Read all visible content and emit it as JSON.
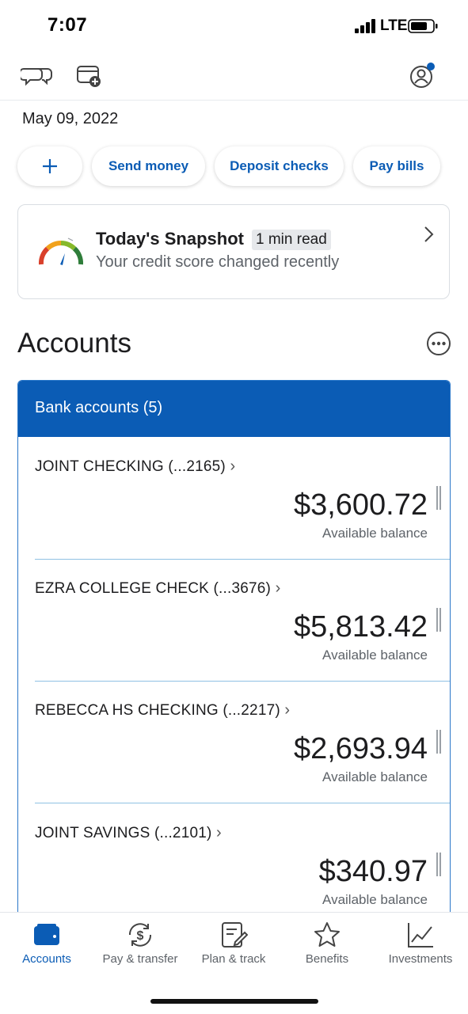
{
  "status_bar": {
    "time": "7:07",
    "network": "LTE"
  },
  "header": {
    "date": "May 09, 2022",
    "icons": [
      "chat-icon",
      "add-card-icon",
      "profile-icon"
    ],
    "profile_notification": true
  },
  "quick_actions": {
    "add_icon": "plus-icon",
    "send_money": "Send money",
    "deposit_checks": "Deposit checks",
    "pay_bills": "Pay bills"
  },
  "snapshot": {
    "icon": "gauge-icon",
    "title": "Today's Snapshot",
    "badge": "1 min read",
    "subtitle": "Your credit score changed recently"
  },
  "accounts": {
    "heading": "Accounts",
    "bank_header": "Bank accounts (5)",
    "items": [
      {
        "name": "JOINT CHECKING (...2165)",
        "amount": "$3,600.72",
        "balance_label": "Available balance"
      },
      {
        "name": "EZRA COLLEGE CHECK (...3676)",
        "amount": "$5,813.42",
        "balance_label": "Available balance"
      },
      {
        "name": "REBECCA HS CHECKING (...2217)",
        "amount": "$2,693.94",
        "balance_label": "Available balance"
      },
      {
        "name": "JOINT SAVINGS (...2101)",
        "amount": "$340.97",
        "balance_label": "Available balance"
      }
    ]
  },
  "bottom_nav": {
    "items": [
      {
        "label": "Accounts",
        "icon": "wallet-icon",
        "active": true
      },
      {
        "label": "Pay & transfer",
        "icon": "pay-transfer-icon",
        "active": false
      },
      {
        "label": "Plan & track",
        "icon": "plan-track-icon",
        "active": false
      },
      {
        "label": "Benefits",
        "icon": "star-icon",
        "active": false
      },
      {
        "label": "Investments",
        "icon": "chart-icon",
        "active": false
      }
    ]
  },
  "colors": {
    "brand_blue": "#0b5cb5",
    "divider": "#8fc1e3",
    "notification": "#0b5cb5"
  }
}
